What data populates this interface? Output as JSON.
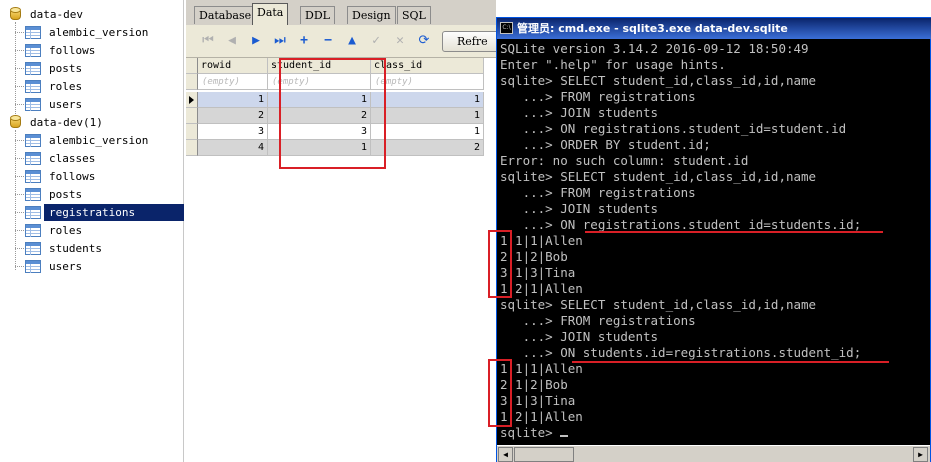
{
  "tree": {
    "db1": {
      "name": "data-dev",
      "tables": [
        "alembic_version",
        "follows",
        "posts",
        "roles",
        "users"
      ]
    },
    "db2": {
      "name": "data-dev(1)",
      "tables": [
        "alembic_version",
        "classes",
        "follows",
        "posts",
        "registrations",
        "roles",
        "students",
        "users"
      ],
      "selected": "registrations"
    }
  },
  "tabs": [
    "Database",
    "Data",
    "DDL",
    "Design",
    "SQL"
  ],
  "active_tab": "Data",
  "toolbar": {
    "icons": [
      "first-icon",
      "prev-icon",
      "next-icon",
      "last-icon",
      "add-icon",
      "delete-icon",
      "up-icon",
      "post-icon",
      "cancel-icon",
      "refresh-icon"
    ],
    "refresh_label": "Refre"
  },
  "grid": {
    "columns": [
      "rowid",
      "student_id",
      "class_id"
    ],
    "filter_placeholder": "(empty)",
    "rows": [
      [
        "1",
        "1",
        "1"
      ],
      [
        "2",
        "2",
        "1"
      ],
      [
        "3",
        "3",
        "1"
      ],
      [
        "4",
        "1",
        "2"
      ]
    ]
  },
  "console": {
    "title": "管理员: cmd.exe - sqlite3.exe  data-dev.sqlite",
    "icon_text": "C:\\",
    "lines": [
      "SQLite version 3.14.2 2016-09-12 18:50:49",
      "Enter \".help\" for usage hints.",
      "sqlite> SELECT student_id,class_id,id,name",
      "   ...> FROM registrations",
      "   ...> JOIN students",
      "   ...> ON registrations.student_id=student.id",
      "   ...> ORDER BY student.id;",
      "Error: no such column: student.id",
      "sqlite> SELECT student_id,class_id,id,name",
      "   ...> FROM registrations",
      "   ...> JOIN students",
      "   ...> ON registrations.student_id=students.id;",
      "1|1|1|Allen",
      "2|1|2|Bob",
      "3|1|3|Tina",
      "1|2|1|Allen",
      "sqlite> SELECT student_id,class_id,id,name",
      "   ...> FROM registrations",
      "   ...> JOIN students",
      "   ...> ON students.id=registrations.student_id;",
      "1|1|1|Allen",
      "2|1|2|Bob",
      "3|1|3|Tina",
      "1|2|1|Allen",
      "sqlite> "
    ]
  },
  "colors": {
    "annotation": "#d91f26",
    "selection": "#0a246a",
    "console_bg": "#000000",
    "console_text": "#c0c0c0"
  }
}
